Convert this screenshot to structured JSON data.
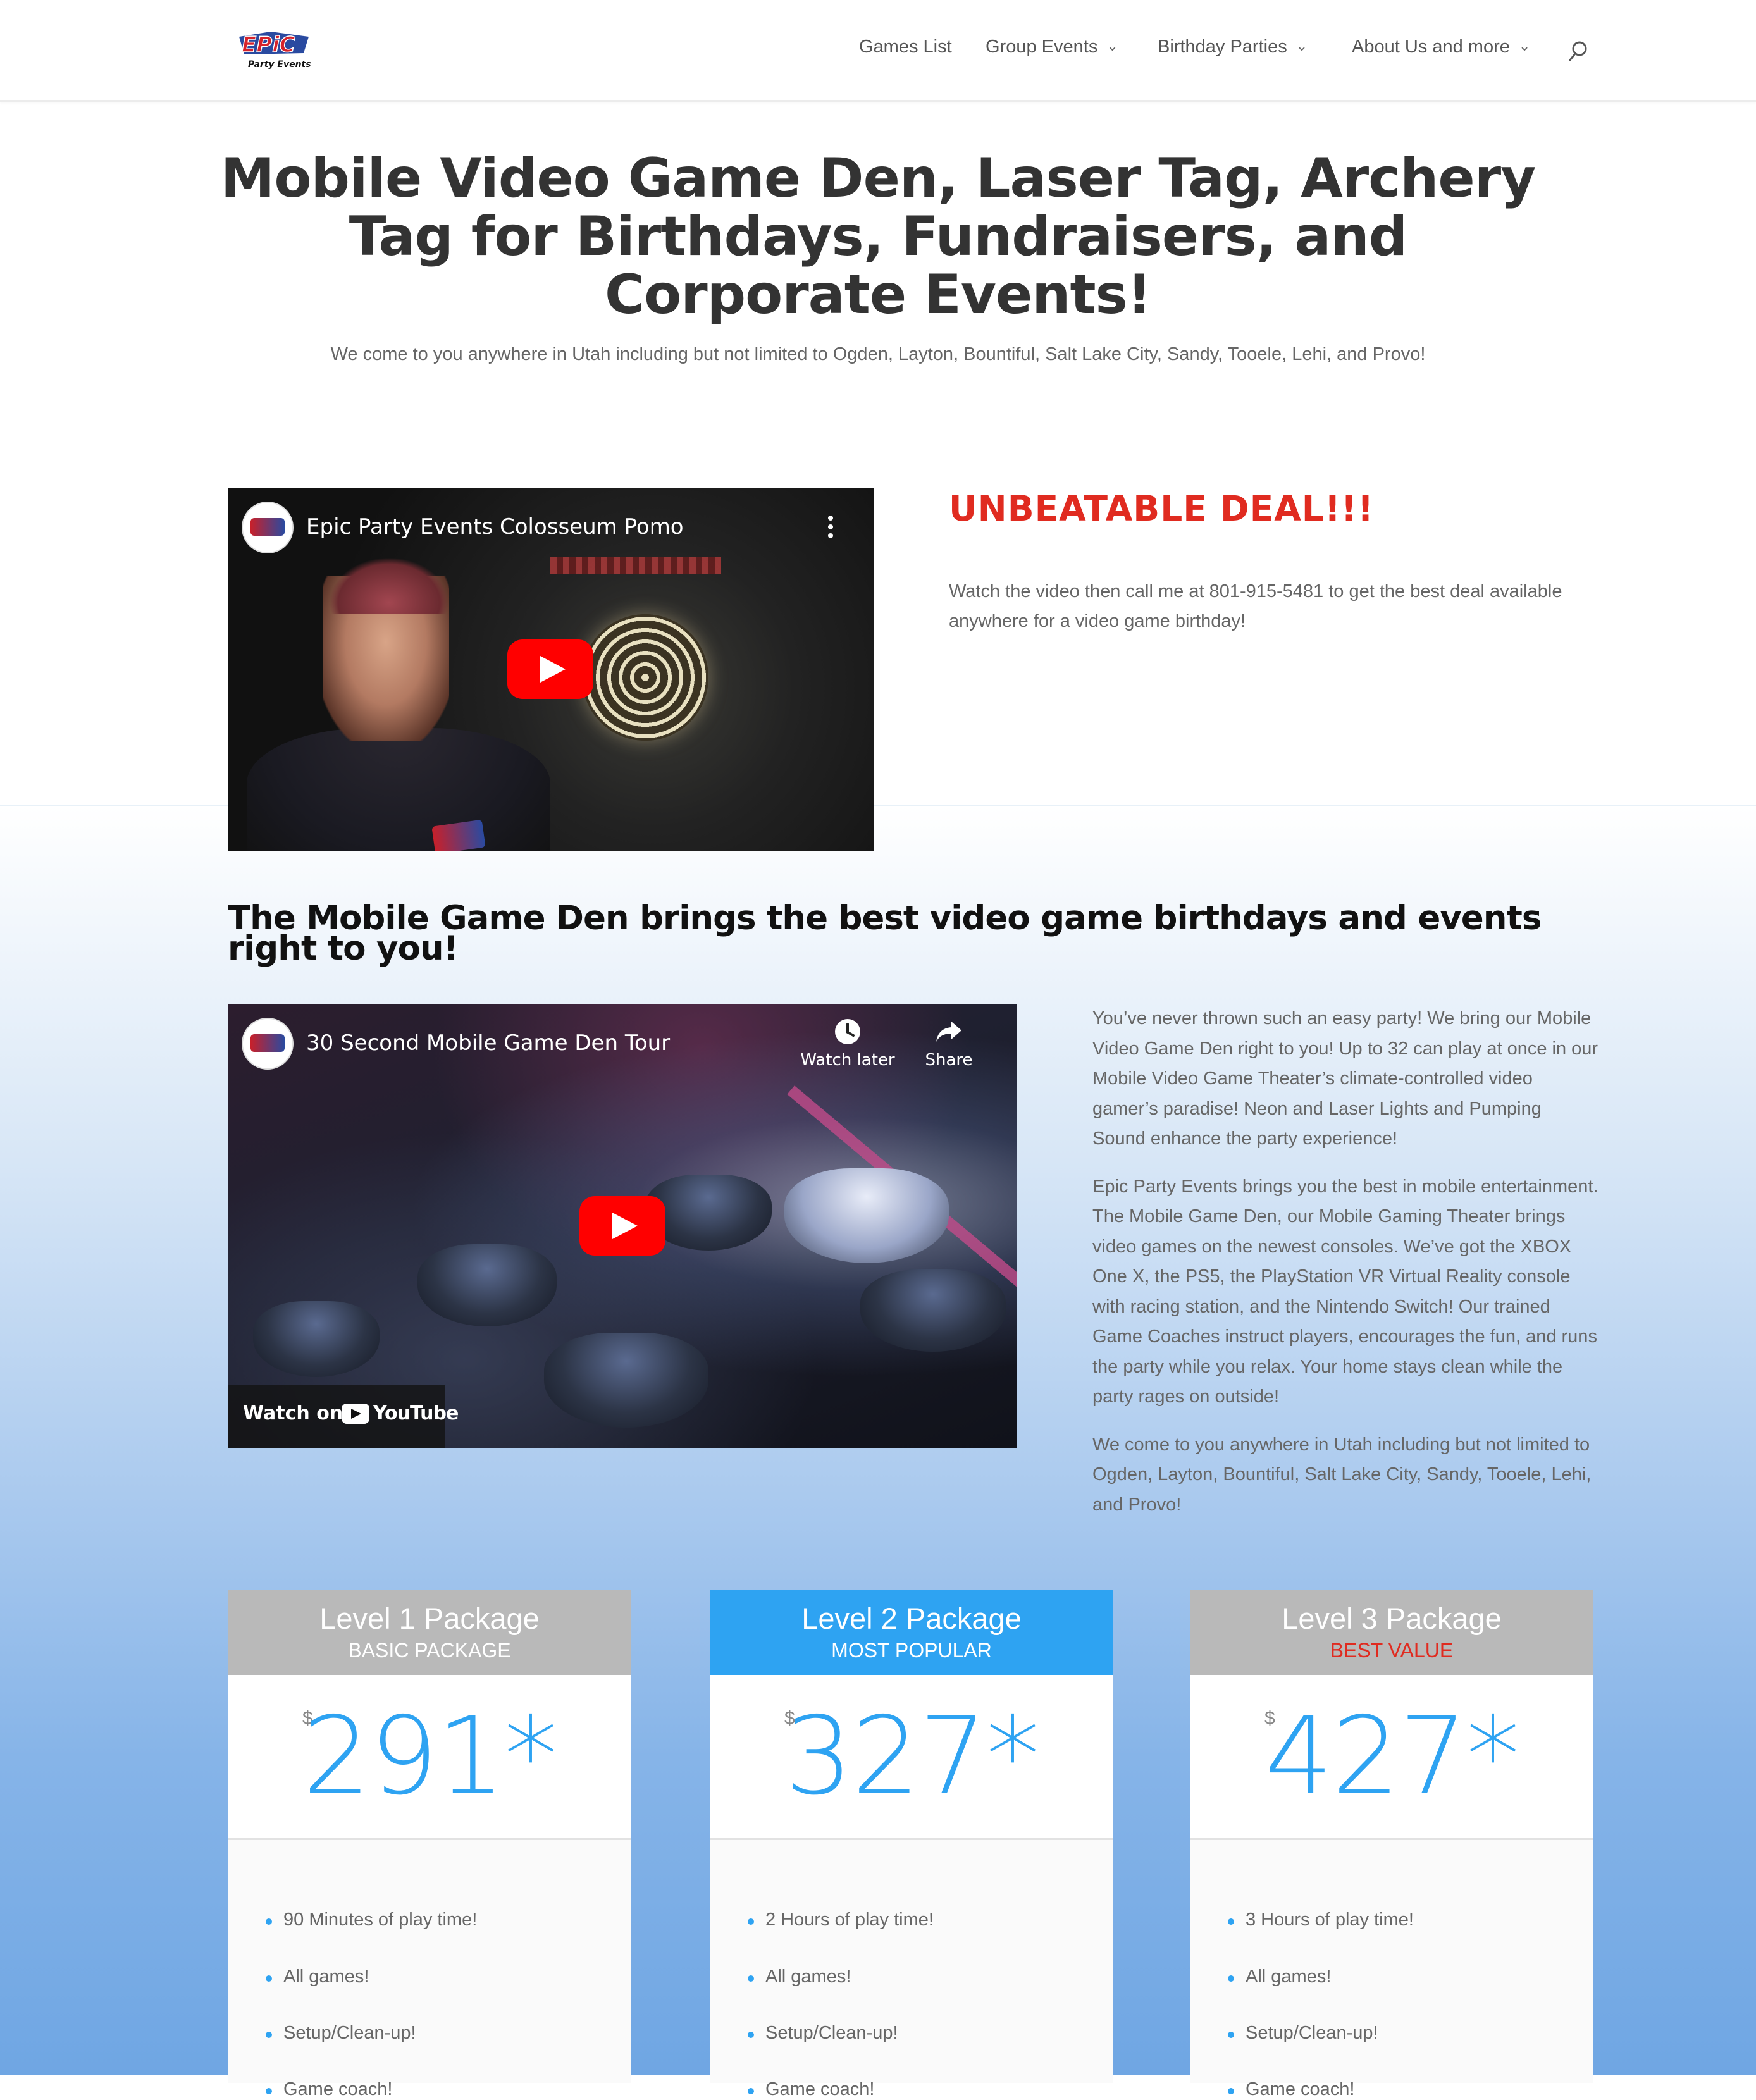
{
  "nav": {
    "logo_alt": "Epic Party Events",
    "items": [
      {
        "label": "Games List",
        "has_dropdown": false
      },
      {
        "label": "Group Events",
        "has_dropdown": true
      },
      {
        "label": "Birthday Parties",
        "has_dropdown": true
      },
      {
        "label": "About Us and more",
        "has_dropdown": true
      }
    ],
    "search_icon": "search-icon"
  },
  "hero": {
    "title": "Mobile Video Game Den, Laser Tag, Archery Tag for Birthdays, Fundraisers, and Corporate Events!",
    "subtitle": "We come to you anywhere in Utah including but not limited to Ogden, Layton, Bountiful, Salt Lake City, Sandy, Tooele, Lehi, and Provo!"
  },
  "video1": {
    "title": "Epic Party Events Colosseum Pomo",
    "menu_icon": "more-vert-icon",
    "play_icon": "play-icon"
  },
  "deal": {
    "title": "UNBEATABLE DEAL!!!",
    "text": "Watch the video then call me at 801-915-5481 to get the best deal available anywhere for a video game birthday!"
  },
  "den": {
    "heading": "The Mobile Game Den brings the best video game birthdays and events right to you!",
    "video": {
      "title": "30 Second Mobile Game Den Tour",
      "watch_later": "Watch later",
      "share": "Share",
      "watch_on": "Watch on",
      "youtube": "YouTube"
    },
    "paragraphs": [
      "You’ve never thrown such an easy party! We bring our Mobile Video Game Den right to you! Up to 32 can play at once in our Mobile Video Game Theater’s climate-controlled video gamer’s paradise! Neon and Laser Lights and Pumping Sound enhance the party experience!",
      "Epic Party Events brings you the best in mobile entertainment. The Mobile Game Den, our Mobile Gaming Theater brings video games on the newest consoles. We’ve got the XBOX One X, the PS5, the PlayStation VR Virtual Reality console with racing station, and the Nintendo Switch! Our trained Game Coaches instruct players, encourages the fun, and runs the party while you relax. Your home stays clean while the party rages on outside!",
      "We come to you anywhere in Utah including but not limited to Ogden, Layton, Bountiful, Salt Lake City, Sandy, Tooele, Lehi, and Provo!"
    ]
  },
  "pricing": [
    {
      "title": "Level 1 Package",
      "subtitle": "BASIC PACKAGE",
      "currency": "$",
      "price": "291*",
      "features": [
        "90 Minutes of play time!",
        "All games!",
        "Setup/Clean-up!",
        "Game coach!"
      ]
    },
    {
      "title": "Level 2 Package",
      "subtitle": "MOST POPULAR",
      "currency": "$",
      "price": "327*",
      "features": [
        "2 Hours of play time!",
        "All games!",
        "Setup/Clean-up!",
        "Game coach!"
      ]
    },
    {
      "title": "Level 3 Package",
      "subtitle": "BEST VALUE",
      "currency": "$",
      "price": "427*",
      "features": [
        "3 Hours of play time!",
        "All games!",
        "Setup/Clean-up!",
        "Game coach!"
      ]
    }
  ],
  "colors": {
    "accent": "#2ea3f2",
    "deal_red": "#e02b20",
    "header_gray": "#b9b9b9"
  }
}
